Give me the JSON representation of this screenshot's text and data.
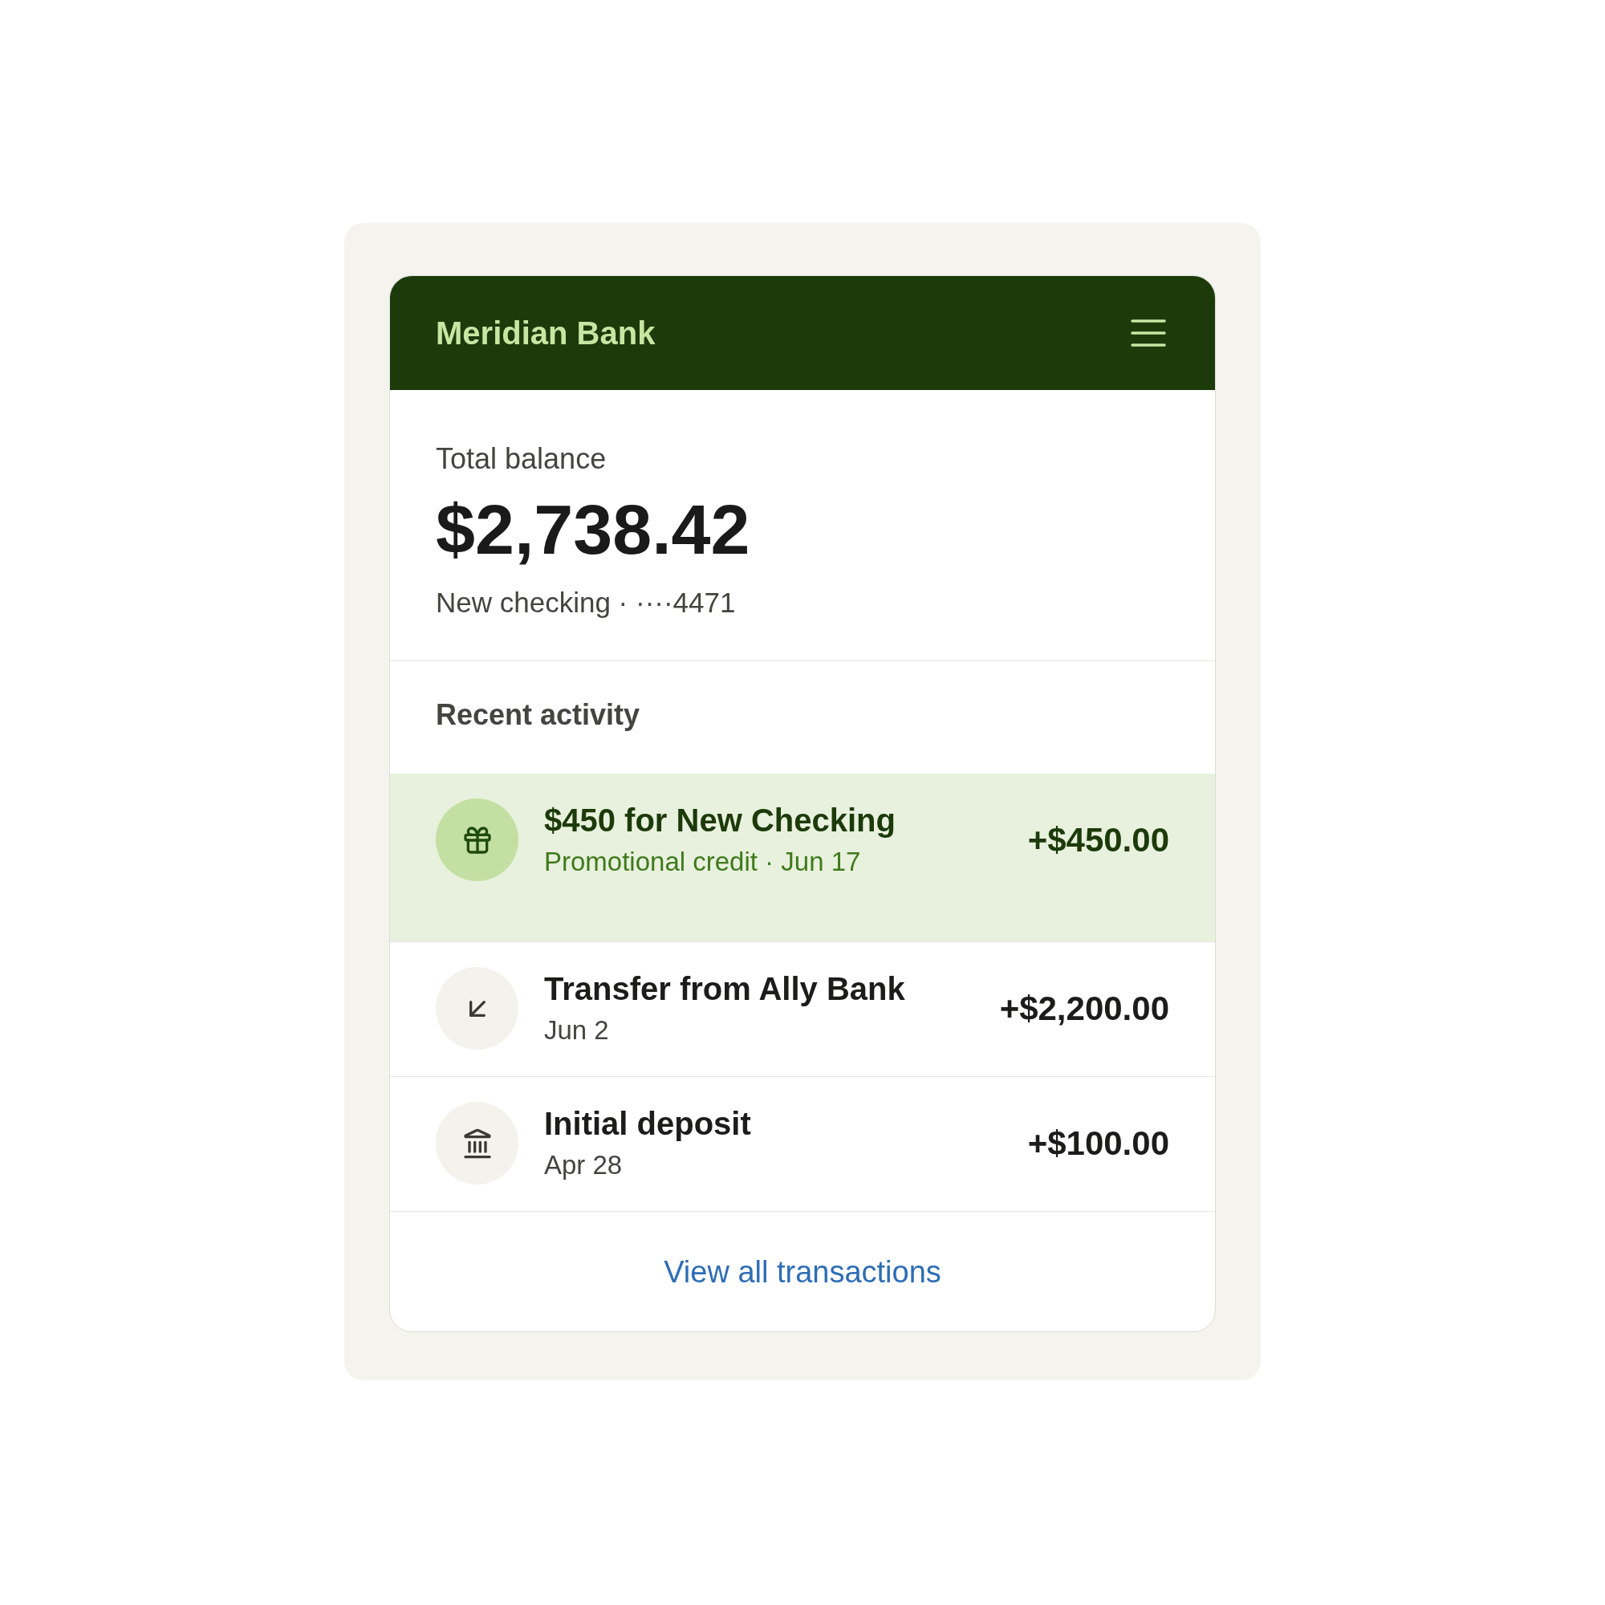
{
  "header": {
    "title": "Meridian Bank"
  },
  "balance": {
    "label": "Total balance",
    "amount": "$2,738.42",
    "account": "New checking · ····4471"
  },
  "activity": {
    "heading": "Recent activity",
    "transactions": [
      {
        "kind": "promo",
        "title": "$450 for New Checking",
        "subtitle": "Promotional credit · Jun 17",
        "amount": "+$450.00",
        "highlighted": true
      },
      {
        "kind": "transfer",
        "title": "Transfer from Ally Bank",
        "subtitle": "Jun 2",
        "amount": "+$2,200.00",
        "highlighted": false
      },
      {
        "kind": "deposit",
        "title": "Initial deposit",
        "subtitle": "Apr 28",
        "amount": "+$100.00",
        "highlighted": false
      }
    ]
  },
  "footer": {
    "link": "View all transactions"
  }
}
